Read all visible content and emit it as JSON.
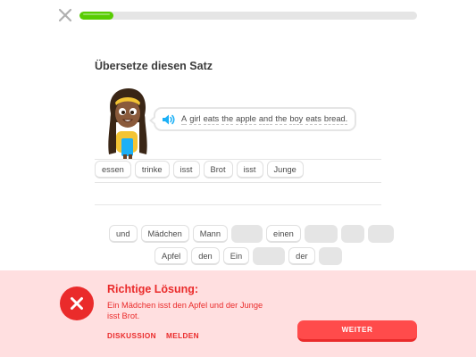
{
  "header": {
    "close_icon": "close-icon",
    "progress_percent": 10,
    "progress_color": "#58cc02"
  },
  "prompt": {
    "title": "Übersetze diesen Satz",
    "speaker_icon": "speaker-icon",
    "sentence_words": [
      "A",
      "girl",
      "eats",
      "the",
      "apple",
      "and",
      "the",
      "boy",
      "eats",
      "bread."
    ]
  },
  "answer": {
    "tiles": [
      "essen",
      "trinke",
      "isst",
      "Brot",
      "isst",
      "Junge"
    ]
  },
  "word_bank": {
    "row1": [
      {
        "label": "und",
        "used": false
      },
      {
        "label": "Mädchen",
        "used": false
      },
      {
        "label": "Mann",
        "used": false
      },
      {
        "label": "",
        "used": true
      },
      {
        "label": "einen",
        "used": false
      },
      {
        "label": "",
        "used": true
      },
      {
        "label": "",
        "used": true
      },
      {
        "label": "",
        "used": true
      }
    ],
    "row2": [
      {
        "label": "Apfel",
        "used": false
      },
      {
        "label": "den",
        "used": false
      },
      {
        "label": "Ein",
        "used": false
      },
      {
        "label": "",
        "used": true
      },
      {
        "label": "der",
        "used": false
      },
      {
        "label": "",
        "used": true
      }
    ]
  },
  "feedback": {
    "icon": "error-x-icon",
    "title": "Richtige Lösung:",
    "solution": "Ein Mädchen isst den Apfel und der Junge isst Brot.",
    "discuss_label": "DISKUSSION",
    "report_label": "MELDEN",
    "continue_label": "WEITER",
    "colors": {
      "background": "#ffdfe0",
      "accent": "#ea2b2b",
      "button": "#ff4b4b"
    }
  }
}
